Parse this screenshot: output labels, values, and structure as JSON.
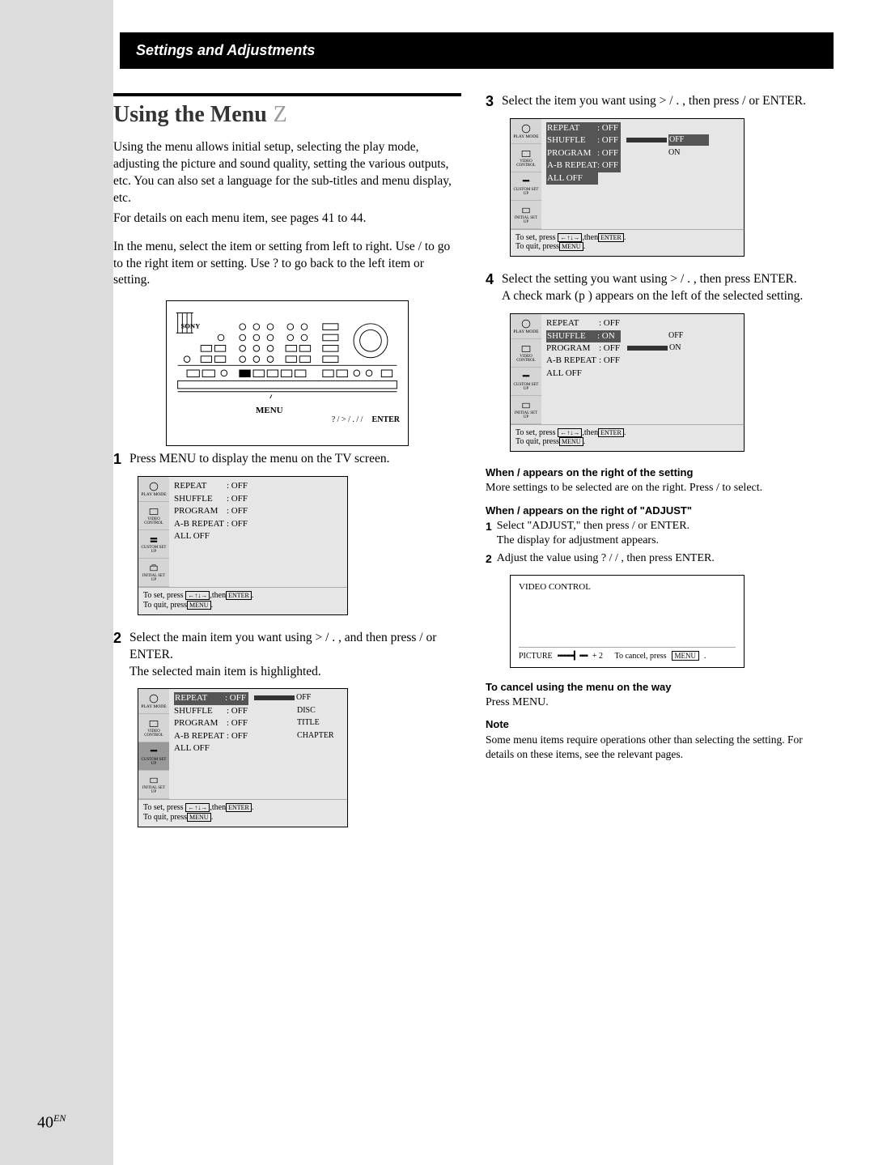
{
  "header": "Settings and Adjustments",
  "title": "Using the Menu",
  "titleMark": "Z",
  "intro1": "Using the menu allows initial setup, selecting the play mode, adjusting the picture and sound quality, setting the various outputs, etc.  You can also set a language for the sub-titles and menu display, etc.",
  "intro2": "For details on each menu item, see pages 41 to 44.",
  "intro3": "In the menu, select the item or setting from left to right.  Use /   to go to the right item or setting.  Use ?   to go back to the left item or setting.",
  "dev": {
    "brand": "SONY",
    "menu": "MENU",
    "enter": "ENTER",
    "arrows": "? / > / . / /"
  },
  "steps": {
    "s1": {
      "n": "1",
      "t": "Press MENU to display the menu on the TV screen."
    },
    "s2": {
      "n": "2",
      "t": "Select the main item you want using > / . , and then press /   or ENTER.",
      "t2": "The selected main item is highlighted."
    },
    "s3": {
      "n": "3",
      "t": "Select the item you want using > / . , then press /   or ENTER."
    },
    "s4": {
      "n": "4",
      "t": "Select the setting you want using > / . , then press ENTER.",
      "t2": "A check mark (p ) appears on the left of the selected setting."
    }
  },
  "scr": {
    "side": [
      "PLAY MODE",
      "",
      "VIDEO CONTROL",
      "",
      "CUSTOM SET UP",
      "",
      "INITIAL SET UP"
    ],
    "rows": [
      {
        "l": "REPEAT",
        "v": ": OFF"
      },
      {
        "l": "SHUFFLE",
        "v": ": OFF"
      },
      {
        "l": "PROGRAM",
        "v": ": OFF"
      },
      {
        "l": "A-B REPEAT",
        "v": ": OFF"
      },
      {
        "l": "ALL OFF",
        "v": ""
      }
    ],
    "bot1": "To  set, press",
    "bot1b": ",then",
    "bot1c": "ENTER",
    "bot1d": ".",
    "bot2": "To  quit, press",
    "bot2b": "MENU",
    "bot2c": "."
  },
  "scr2opts": [
    "OFF",
    "DISC",
    "TITLE",
    "CHAPTER"
  ],
  "scr3": {
    "row1hl": "REPEAT",
    "opts": [
      {
        "m": true,
        "t": "OFF"
      },
      {
        "m": false,
        "t": "ON"
      }
    ]
  },
  "scr4": {
    "r": [
      {
        "l": "REPEAT",
        "v": ": OFF"
      },
      {
        "l": "SHUFFLE",
        "v": ": ON",
        "hl": true
      },
      {
        "l": "PROGRAM",
        "v": ": OFF"
      },
      {
        "l": "A-B REPEAT",
        "v": ": OFF"
      },
      {
        "l": "ALL OFF",
        "v": ""
      }
    ],
    "opts": [
      {
        "m": false,
        "t": "OFF"
      },
      {
        "m": true,
        "t": "ON"
      }
    ]
  },
  "sub1": {
    "h": "When /   appears on the right of the setting",
    "t": "More settings to be selected are on the right.  Press /   to select."
  },
  "sub2": {
    "h": "When /   appears on the right of \"ADJUST\"",
    "i1": "Select \"ADJUST,\" then press /   or ENTER.",
    "i1b": "The display for adjustment appears.",
    "i2": "Adjust the value using ? / /  , then press ENTER."
  },
  "adj": {
    "title": "VIDEO CONTROL",
    "pic": "PICTURE",
    "bar": "▪▪▪▪▪▪▪▪▎▪▪▪▪",
    "plus": "+ 2",
    "cancel": "To cancel, press",
    "btn": "MENU"
  },
  "cancel": {
    "h": "To cancel using the menu on the way",
    "t": "Press MENU."
  },
  "note": {
    "h": "Note",
    "t": "Some menu items require operations other than selecting the setting.  For details on these items, see the relevant pages."
  },
  "page": "40",
  "pageSuf": "EN"
}
